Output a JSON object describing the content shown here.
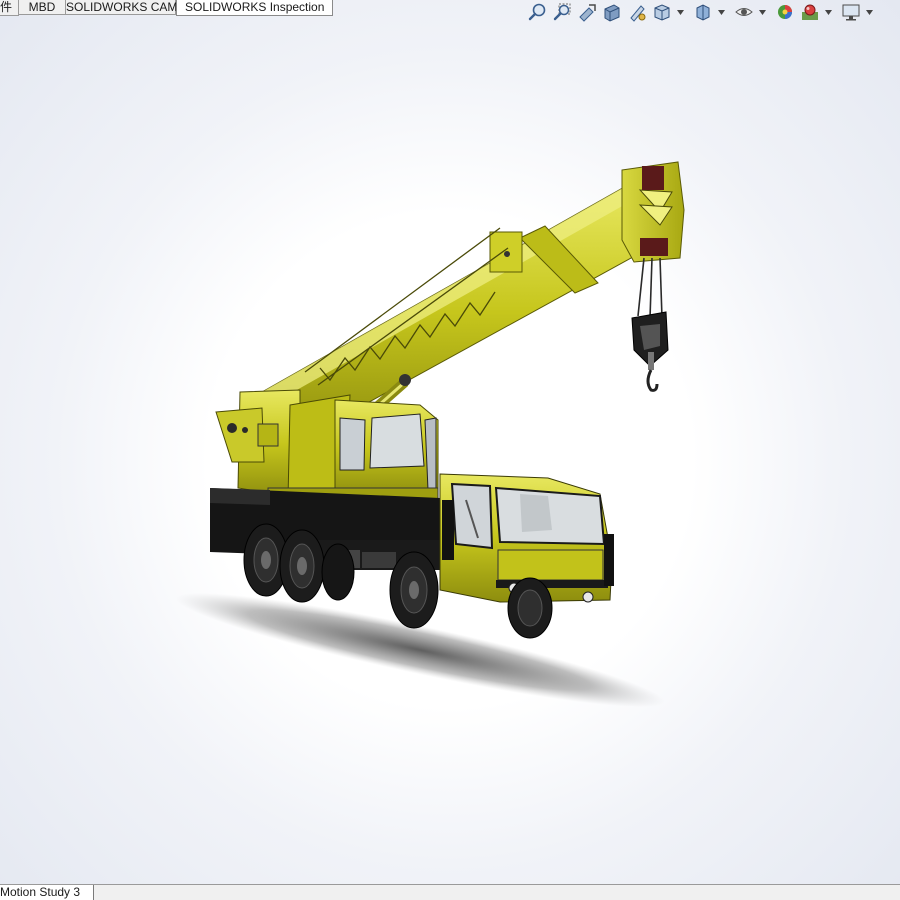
{
  "tabs": [
    {
      "label": "件",
      "active": false
    },
    {
      "label": "MBD",
      "active": false
    },
    {
      "label": "SOLIDWORKS CAM",
      "active": false
    },
    {
      "label": "SOLIDWORKS Inspection",
      "active": true
    }
  ],
  "heads_up_toolbar": {
    "buttons": [
      {
        "icon": "zoom-to-fit-icon"
      },
      {
        "icon": "zoom-to-area-icon"
      },
      {
        "icon": "previous-view-icon"
      },
      {
        "icon": "section-view-icon"
      },
      {
        "icon": "dynamic-annotation-views-icon"
      },
      {
        "icon": "view-orientation-icon",
        "dropdown": true
      },
      {
        "icon": "display-style-icon",
        "dropdown": true
      },
      {
        "icon": "hide-show-items-icon",
        "dropdown": true
      },
      {
        "icon": "edit-appearance-icon"
      },
      {
        "icon": "apply-scene-icon",
        "dropdown": true
      },
      {
        "icon": "view-settings-icon",
        "dropdown": true
      }
    ]
  },
  "model": {
    "name": "truck-crane-assembly",
    "colors": {
      "body_yellow": "#c8c81a",
      "body_yellow_light": "#e6e65a",
      "body_yellow_dark": "#8f8f10",
      "black": "#141414",
      "tire": "#1c1c1c",
      "glass": "#d9dde0",
      "hook_red": "#5a1a1a"
    }
  },
  "statusbar": {
    "motion_study_tab": "Motion Study 3"
  }
}
